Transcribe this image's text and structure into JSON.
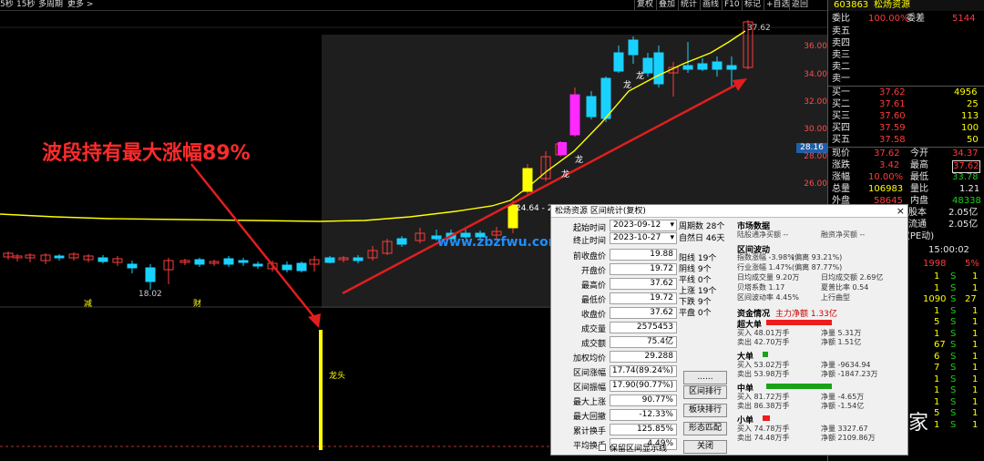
{
  "topbar": {
    "items": [
      "5秒",
      "15秒",
      "多周期",
      "更多 >"
    ],
    "buttons": [
      "复权",
      "叠加",
      "统计",
      "画线",
      "F10",
      "标记",
      "+自选",
      "返回"
    ]
  },
  "headline": "波段持有最大涨幅89%",
  "chart": {
    "low_label": "18.02",
    "high_label": "37.62",
    "start_label": "24.64 - 25",
    "marker_jian": "减",
    "marker_cai": "财",
    "longtou": "龙头",
    "long_marks": [
      "龙",
      "龙",
      "龙",
      "龙"
    ],
    "price_ticks": [
      "36.00",
      "34.00",
      "32.00",
      "30.00",
      "28.00",
      "26.00"
    ],
    "price_box": "28.16",
    "watermark": "www.zbzfwu.com"
  },
  "quote": {
    "code": "603863",
    "name": "松炀资源",
    "weibi_label": "委比",
    "weibi_value": "100.00%",
    "weicha_label": "委差",
    "weicha_value": "5144",
    "sell": [
      "卖五",
      "卖四",
      "卖三",
      "卖二",
      "卖一"
    ],
    "buy": [
      {
        "label": "买一",
        "price": "37.62",
        "vol": "4956"
      },
      {
        "label": "买二",
        "price": "37.61",
        "vol": "25"
      },
      {
        "label": "买三",
        "price": "37.60",
        "vol": "113"
      },
      {
        "label": "买四",
        "price": "37.59",
        "vol": "100"
      },
      {
        "label": "买五",
        "price": "37.58",
        "vol": "50"
      }
    ],
    "stats": [
      {
        "l1": "现价",
        "v1": "37.62",
        "l2": "今开",
        "v2": "34.37",
        "c1": "red",
        "c2": "red"
      },
      {
        "l1": "涨跌",
        "v1": "3.42",
        "l2": "最高",
        "v2": "37.62",
        "c1": "red",
        "c2": "red"
      },
      {
        "l1": "涨幅",
        "v1": "10.00%",
        "l2": "最低",
        "v2": "33.78",
        "c1": "red",
        "c2": "green"
      },
      {
        "l1": "总量",
        "v1": "106983",
        "l2": "量比",
        "v2": "1.21",
        "c1": "yellow",
        "c2": "white"
      },
      {
        "l1": "外盘",
        "v1": "58645",
        "l2": "内盘",
        "v2": "48338",
        "c1": "red",
        "c2": "green"
      }
    ],
    "extra": [
      {
        "l": "股本",
        "v": "2.05亿"
      },
      {
        "l": "流通",
        "v": "2.05亿"
      },
      {
        "l": "(PE动)",
        "v": ""
      }
    ],
    "time": "15:00:02",
    "bottom_vol": "1998",
    "bottom_pct": "5%",
    "ticks": [
      {
        "a": "1",
        "b": "S",
        "c": "1"
      },
      {
        "a": "1",
        "b": "S",
        "c": "1"
      },
      {
        "a": "1090",
        "b": "S",
        "c": "27"
      },
      {
        "a": "1",
        "b": "S",
        "c": "1"
      },
      {
        "a": "5",
        "b": "S",
        "c": "1"
      },
      {
        "a": "1",
        "b": "S",
        "c": "1"
      },
      {
        "a": "67",
        "b": "S",
        "c": "1"
      },
      {
        "a": "6",
        "b": "S",
        "c": "1"
      },
      {
        "a": "7",
        "b": "S",
        "c": "1"
      },
      {
        "a": "1",
        "b": "S",
        "c": "1"
      },
      {
        "a": "1",
        "b": "S",
        "c": "1"
      },
      {
        "a": "1",
        "b": "S",
        "c": "1"
      },
      {
        "a": "5",
        "b": "S",
        "c": "1"
      },
      {
        "a": "1",
        "b": "S",
        "c": "1"
      }
    ]
  },
  "dialog": {
    "title": "松炀资源 区间统计(复权)",
    "close": "×",
    "start_label": "起始时间",
    "start_value": "2023-09-12",
    "end_label": "终止时间",
    "end_value": "2023-10-27",
    "rows": [
      {
        "label": "前收盘价",
        "value": "19.88"
      },
      {
        "label": "开盘价",
        "value": "19.72"
      },
      {
        "label": "最高价",
        "value": "37.62"
      },
      {
        "label": "最低价",
        "value": "19.72"
      },
      {
        "label": "收盘价",
        "value": "37.62"
      },
      {
        "label": "成交量",
        "value": "2575453"
      },
      {
        "label": "成交额",
        "value": "75.4亿"
      },
      {
        "label": "加权均价",
        "value": "29.288"
      },
      {
        "label": "区间涨幅",
        "value": "17.74(89.24%)"
      },
      {
        "label": "区间振幅",
        "value": "17.90(90.77%)"
      },
      {
        "label": "最大上涨",
        "value": "90.77%"
      },
      {
        "label": "最大回撤",
        "value": "-12.33%"
      },
      {
        "label": "累计换手",
        "value": "125.85%"
      },
      {
        "label": "平均换手",
        "value": "4.49%"
      }
    ],
    "checkbox_label": "保留区间显示线",
    "period": [
      "周期数 28个",
      "自然日 46天"
    ],
    "counts": [
      "阳线 19个",
      "阴线 9个",
      "平线 0个",
      "上涨 19个",
      "下跌 9个",
      "平盘 0个"
    ],
    "buttons": [
      "......",
      "区间排行",
      "板块排行",
      "形态匹配",
      "关闭"
    ],
    "market_title": "市场数据",
    "market_left": "陆股通净买额 --",
    "market_right": "融资净买额 --",
    "wave_title": "区间波动",
    "wave": [
      {
        "l": "指数涨幅 -3.98%",
        "r": "(偏离 93.21%)"
      },
      {
        "l": "行业涨幅 1.47%",
        "r": "(偏离 87.77%)"
      },
      {
        "l": "日均成交量 9.20万",
        "r": "日均成交额 2.69亿"
      },
      {
        "l": "贝塔系数 1.17",
        "r": "夏普比率 0.54"
      },
      {
        "l": "区间波动率 4.45%",
        "r": "上行曲型"
      }
    ],
    "fund_title": "资金情况",
    "fund_main": "主力净额 1.33亿",
    "groups": [
      {
        "name": "超大单",
        "buy": "买入 48.01万手",
        "sell": "卖出 42.70万手",
        "net": "净量 5.31万",
        "amt": "净额 1.51亿",
        "color": "#ee1c1c",
        "frac": 0.95
      },
      {
        "name": "大单",
        "buy": "买入 53.02万手",
        "sell": "卖出 53.98万手",
        "net": "净量 -9634.94",
        "amt": "净额 -1847.23万",
        "color": "#19a319",
        "frac": 0.08
      },
      {
        "name": "中单",
        "buy": "买入 81.72万手",
        "sell": "卖出 86.38万手",
        "net": "净量 -4.65万",
        "amt": "净额 -1.54亿",
        "color": "#19a319",
        "frac": 0.95
      },
      {
        "name": "小单",
        "buy": "买入 74.78万手",
        "sell": "卖出 74.48万手",
        "net": "净量 3327.67",
        "amt": "净额 2109.86万",
        "color": "#ee1c1c",
        "frac": 0.1
      }
    ]
  },
  "wechat_watermark": "七万起家",
  "colors": {
    "up": "#ff3b3b",
    "down": "#19d1ff",
    "ma": "#ffff00",
    "arrow": "#e01e1e"
  }
}
